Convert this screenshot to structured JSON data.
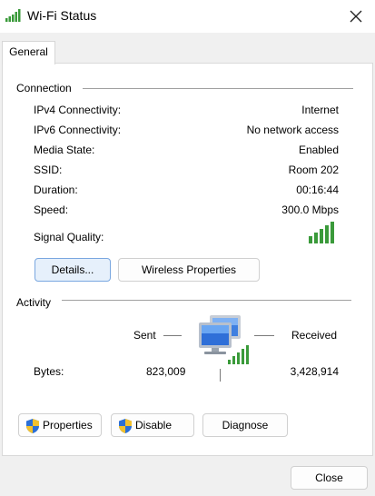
{
  "window": {
    "title": "Wi-Fi Status"
  },
  "tabs": [
    {
      "label": "General"
    }
  ],
  "connection": {
    "heading": "Connection",
    "rows": [
      {
        "label": "IPv4 Connectivity:",
        "value": "Internet"
      },
      {
        "label": "IPv6 Connectivity:",
        "value": "No network access"
      },
      {
        "label": "Media State:",
        "value": "Enabled"
      },
      {
        "label": "SSID:",
        "value": "Room 202"
      },
      {
        "label": "Duration:",
        "value": "00:16:44"
      },
      {
        "label": "Speed:",
        "value": "300.0 Mbps"
      }
    ],
    "signal_label": "Signal Quality:",
    "signal_bars": 5,
    "signal_bars_total": 5,
    "signal_color": "#3a9a3a",
    "details_button": "Details...",
    "wireless_button": "Wireless Properties"
  },
  "activity": {
    "heading": "Activity",
    "sent_label": "Sent",
    "received_label": "Received",
    "bytes_label": "Bytes:",
    "bytes_sent": "823,009",
    "bytes_received": "3,428,914",
    "properties_button": "Properties",
    "disable_button": "Disable",
    "diagnose_button": "Diagnose"
  },
  "footer": {
    "close_button": "Close"
  },
  "icons": {
    "title": "wifi-signal-icon",
    "close": "close-icon",
    "shield": "uac-shield-icon",
    "network": "network-computers-icon"
  },
  "colors": {
    "accent": "#7aa7e0",
    "shield_blue": "#2b6fd6",
    "shield_yellow": "#f2c12e"
  }
}
